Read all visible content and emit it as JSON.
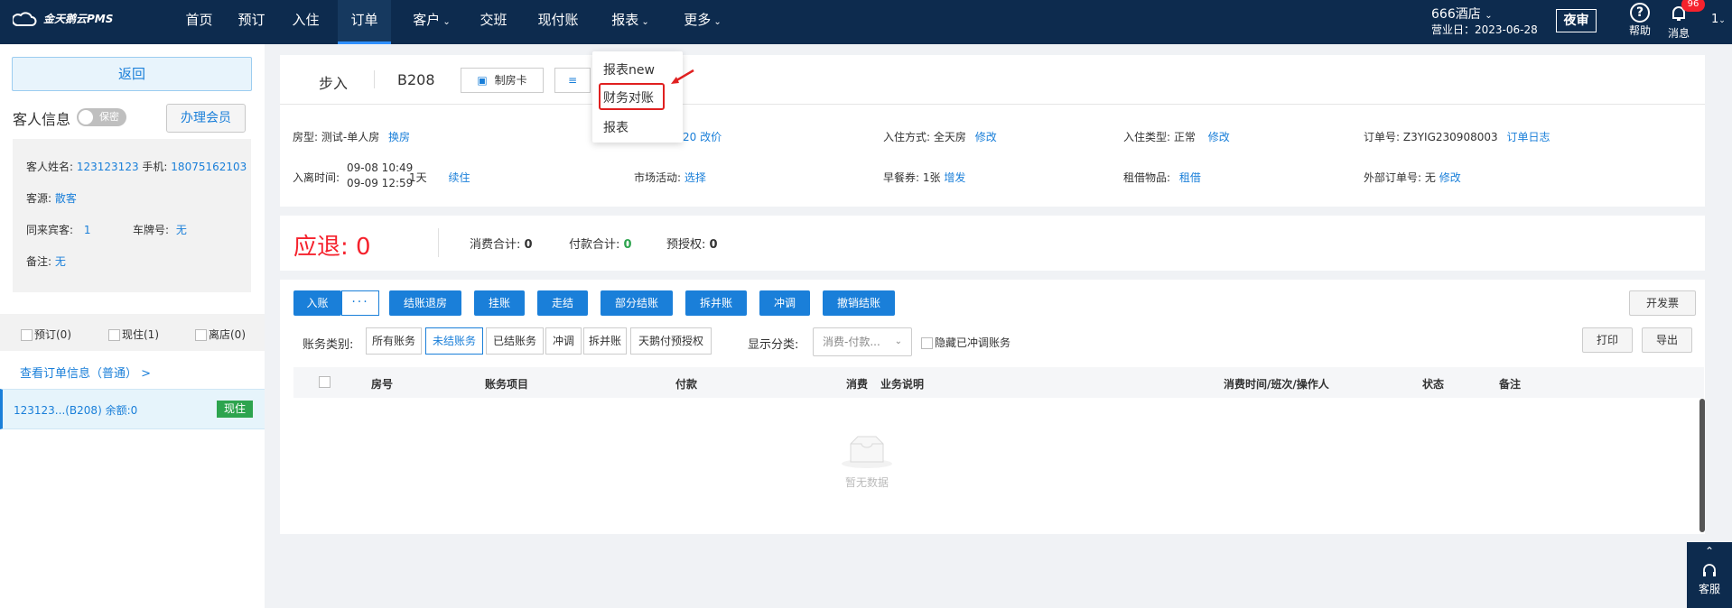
{
  "nav": {
    "logo": "金天鹅云PMS",
    "items": [
      {
        "label": "首页",
        "caret": false
      },
      {
        "label": "预订",
        "caret": false
      },
      {
        "label": "入住",
        "caret": false
      },
      {
        "label": "订单",
        "caret": false,
        "active": true
      },
      {
        "label": "客户",
        "caret": true
      },
      {
        "label": "交班",
        "caret": false
      },
      {
        "label": "现付账",
        "caret": false
      },
      {
        "label": "报表",
        "caret": true
      },
      {
        "label": "更多",
        "caret": true
      }
    ],
    "hotel": "666酒店",
    "biz_date": "营业日：2023-06-28",
    "night_audit": "夜审",
    "help": "帮助",
    "messages": "消息",
    "msg_count": "96",
    "user_short": "1"
  },
  "report_menu": {
    "items": [
      "报表new",
      "财务对账",
      "报表"
    ]
  },
  "left": {
    "back": "返回",
    "guest_info": "客人信息",
    "privacy": "保密",
    "member": "办理会员",
    "guest_name_label": "客人姓名:",
    "guest_name": "123123123",
    "phone_label": "手机:",
    "phone": "18075162103",
    "source_label": "客源:",
    "source": "散客",
    "companion_label": "同来宾客:",
    "companion": "1",
    "plate_label": "车牌号:",
    "plate": "无",
    "note_label": "备注:",
    "note": "无",
    "tabs": [
      "预订(0)",
      "现住(1)",
      "离店(0)"
    ],
    "order_link": "查看订单信息（普通） >",
    "room_row": "123123...(B208)   余额:0",
    "room_status": "现住"
  },
  "order": {
    "steps": "步入",
    "room_no": "B208",
    "make_card": "制房卡",
    "room_type_label": "房型:",
    "room_type": "测试-单人房",
    "change_room": "换房",
    "price_partial": "20",
    "change_price": "改价",
    "checkin_mode_label": "入住方式:",
    "checkin_mode": "全天房",
    "edit1": "修改",
    "checkin_type_label": "入住类型:",
    "checkin_type": "正常",
    "edit2": "修改",
    "order_no_label": "订单号:",
    "order_no": "Z3YIG230908003",
    "order_log": "订单日志",
    "stay_label": "入离时间:",
    "stay_in": "09-08 10:49",
    "stay_out": "09-09 12:59",
    "nights": "1天",
    "extend": "续住",
    "market_label": "市场活动:",
    "market": "选择",
    "breakfast_label": "早餐券:",
    "breakfast": "1张",
    "breakfast_add": "增发",
    "rent_label": "租借物品:",
    "rent": "租借",
    "ext_order_label": "外部订单号:",
    "ext_order": "无",
    "edit3": "修改"
  },
  "summary": {
    "refund": "应退: 0",
    "consume": "消费合计: ",
    "consume_val": "0",
    "pay": "付款合计: ",
    "pay_val": "0",
    "preauth": "预授权: ",
    "preauth_val": "0"
  },
  "ledger": {
    "buttons": [
      "入账",
      "结账退房",
      "挂账",
      "走结",
      "部分结账",
      "拆并账",
      "冲调",
      "撤销结账"
    ],
    "invoice": "开发票",
    "category_label": "账务类别:",
    "categories": [
      "所有账务",
      "未结账务",
      "已结账务",
      "冲调",
      "拆并账",
      "天鹅付预授权"
    ],
    "display_label": "显示分类:",
    "display_value": "消费-付款...",
    "hide_offset": "隐藏已冲调账务",
    "print": "打印",
    "export": "导出",
    "columns": [
      "房号",
      "账务项目",
      "付款",
      "消费",
      "业务说明",
      "消费时间/班次/操作人",
      "状态",
      "备注"
    ],
    "empty": "暂无数据"
  },
  "service": "客服",
  "colors": {
    "nav_bg": "#0d2b4e",
    "primary": "#1a7fd9",
    "danger": "#f5222d",
    "success": "#2da44e"
  }
}
